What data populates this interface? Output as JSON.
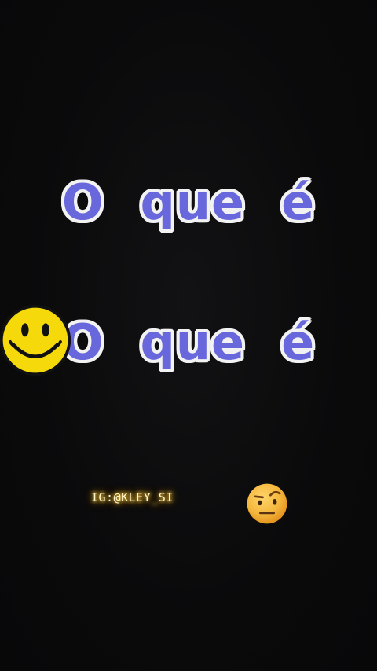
{
  "caption": {
    "line1": [
      "O",
      "que",
      "é"
    ],
    "line2": [
      "O",
      "que",
      "é"
    ]
  },
  "watermark": "IG:@KLEY_SI",
  "stickers": {
    "left": "smiley-face-icon",
    "right": "face-with-raised-eyebrow-icon"
  },
  "colors": {
    "background": "#0b0b0c",
    "caption_fill": "#6868dc",
    "caption_outline": "#f2f2f2",
    "smiley_yellow": "#f5d90a",
    "watermark_glow": "#ffb400"
  }
}
